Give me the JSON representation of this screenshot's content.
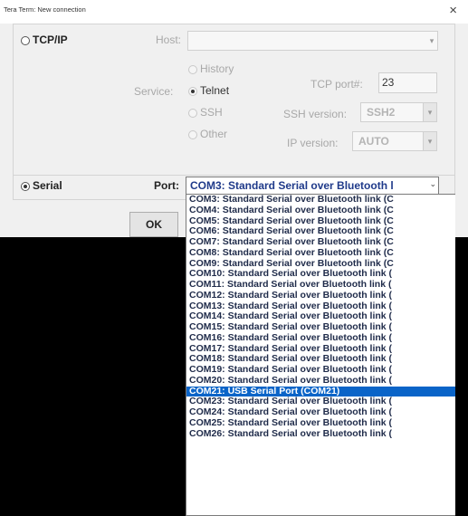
{
  "window": {
    "title": "Tera Term: New connection",
    "close_glyph": "×"
  },
  "tcpip": {
    "label": "TCP/IP",
    "host_label": "Host:",
    "host_value": "",
    "service_label": "Service:",
    "services": [
      "History",
      "Telnet",
      "SSH",
      "Other"
    ],
    "selected_service": "Telnet",
    "tcp_port_label": "TCP port#:",
    "tcp_port_value": "23",
    "ssh_version_label": "SSH version:",
    "ssh_version_value": "SSH2",
    "ip_version_label": "IP version:",
    "ip_version_value": "AUTO"
  },
  "serial": {
    "label": "Serial",
    "port_label": "Port:",
    "port_value": "COM3: Standard Serial over Bluetooth l",
    "ok_label": "OK"
  },
  "dropdown": {
    "selected_index": 18,
    "options": [
      "COM3: Standard Serial over Bluetooth link (C",
      "COM4: Standard Serial over Bluetooth link (C",
      "COM5: Standard Serial over Bluetooth link (C",
      "COM6: Standard Serial over Bluetooth link (C",
      "COM7: Standard Serial over Bluetooth link (C",
      "COM8: Standard Serial over Bluetooth link (C",
      "COM9: Standard Serial over Bluetooth link (C",
      "COM10: Standard Serial over Bluetooth link (",
      "COM11: Standard Serial over Bluetooth link (",
      "COM12: Standard Serial over Bluetooth link (",
      "COM13: Standard Serial over Bluetooth link (",
      "COM14: Standard Serial over Bluetooth link (",
      "COM15: Standard Serial over Bluetooth link (",
      "COM16: Standard Serial over Bluetooth link (",
      "COM17: Standard Serial over Bluetooth link (",
      "COM18: Standard Serial over Bluetooth link (",
      "COM19: Standard Serial over Bluetooth link (",
      "COM20: Standard Serial over Bluetooth link (",
      "COM21: USB Serial Port (COM21)",
      "COM23: Standard Serial over Bluetooth link (",
      "COM24: Standard Serial over Bluetooth link (",
      "COM25: Standard Serial over Bluetooth link (",
      "COM26: Standard Serial over Bluetooth link ("
    ]
  },
  "colors": {
    "selection": "#0a64c8",
    "dialog_bg": "#f0f0f0",
    "backdrop": "#000000"
  }
}
